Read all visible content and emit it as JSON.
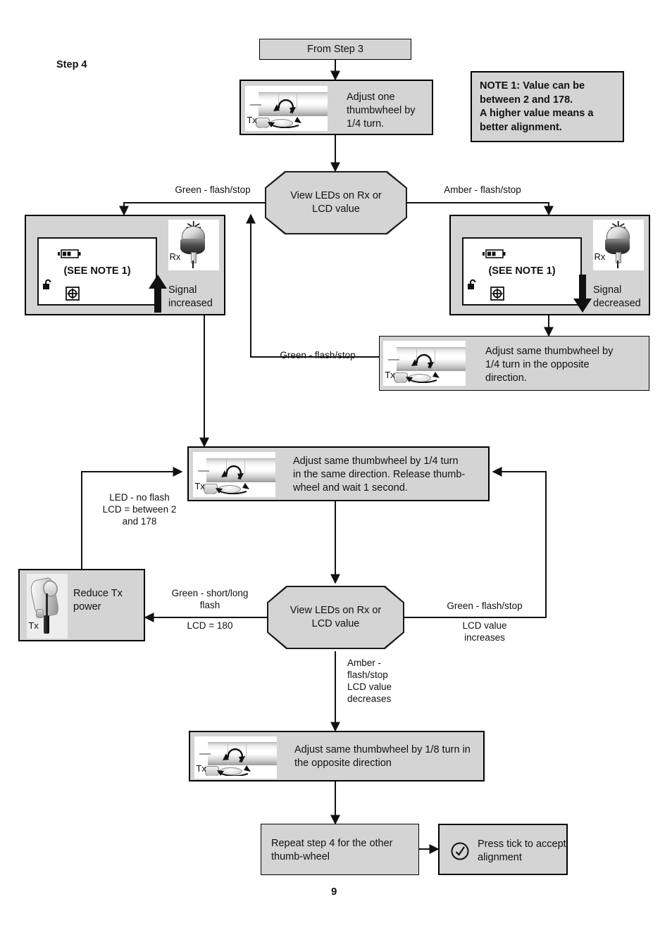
{
  "page": {
    "step_label": "Step 4",
    "page_number": "9"
  },
  "note": {
    "text": "NOTE 1: Value can be\nbetween 2 and 178.\nA higher value means a\nbetter alignment."
  },
  "nodes": {
    "from_step": {
      "label": "From Step 3"
    },
    "adjust_one": {
      "text": "Adjust one\nthumbwheel by\n1/4 turn.",
      "image_label": "Tx"
    },
    "decision_1": {
      "text": "View LEDs on Rx or\nLCD value"
    },
    "signal_increased": {
      "lcd_text": "(SEE NOTE 1)",
      "arrow_direction": "up",
      "caption": "Signal\nincreased",
      "device_label": "Rx"
    },
    "signal_decreased": {
      "lcd_text": "(SEE NOTE 1)",
      "arrow_direction": "down",
      "caption": "Signal\ndecreased",
      "device_label": "Rx"
    },
    "adjust_opposite_quarter": {
      "text": "Adjust same thumbwheel by\n1/4 turn in the opposite\ndirection.",
      "image_label": "Tx"
    },
    "adjust_same_quarter": {
      "text": "Adjust same thumbwheel by 1/4 turn\nin the same direction. Release thumb-\nwheel and wait 1 second.",
      "image_label": "Tx"
    },
    "decision_2": {
      "text": "View LEDs on Rx or\nLCD value"
    },
    "reduce_power": {
      "text": "Reduce Tx\npower",
      "image_label": "Tx"
    },
    "adjust_eighth": {
      "text": "Adjust same thumbwheel by 1/8 turn in\nthe opposite direction",
      "image_label": "Tx"
    },
    "repeat_step": {
      "text": "Repeat step 4 for the other\nthumb-wheel"
    },
    "press_tick": {
      "text": "Press tick to accept\nalignment",
      "icon": "tick-circle-icon"
    }
  },
  "edges": {
    "green_flash_stop_left": "Green - flash/stop",
    "amber_flash_stop_right": "Amber - flash/stop",
    "green_flash_stop_mid": "Green - flash/stop",
    "led_no_flash": "LED - no flash\nLCD = between 2\nand 178",
    "green_short_long_flash": "Green - short/long\nflash",
    "lcd_equals_180": "LCD = 180",
    "green_flash_stop_right": "Green - flash/stop",
    "lcd_value_increases": "LCD value\nincreases",
    "amber_decreases": "Amber -\nflash/stop\nLCD value\ndecreases"
  },
  "colors": {
    "box_fill": "#d4d4d4",
    "box_border": "#000000",
    "page_bg": "#ffffff",
    "text": "#111111"
  }
}
